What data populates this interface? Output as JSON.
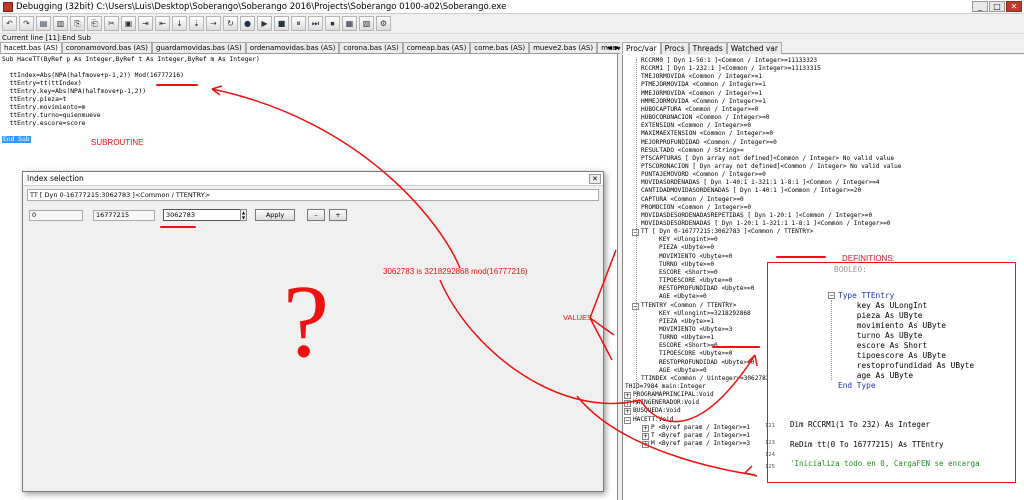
{
  "window": {
    "title": "Debugging (32bit) C:\\Users\\Luis\\Desktop\\Soberango\\Soberango 2016\\Projects\\Soberango 0100-a02\\Soberango.exe",
    "min": "_",
    "max": "□",
    "close": "✕"
  },
  "toolbar": {
    "buttons": [
      "↶",
      "↷",
      "▤",
      "▥",
      "⎘",
      "⎗",
      "✂",
      "▣",
      "⇥",
      "⇤",
      "↓",
      "⇣",
      "⇢",
      "↻",
      "●",
      "▶",
      "■",
      "⏸",
      "⏭",
      "⏹",
      "▦",
      "▧",
      "⚙"
    ]
  },
  "current_line": "Current line [11]:End Sub",
  "tabs": [
    "hacett.bas (AS)",
    "coronamovord.bas (AS)",
    "guardamovidas.bas (AS)",
    "ordenamovidas.bas (AS)",
    "corona.bas (AS)",
    "comeap.bas (AS)",
    "come.bas (AS)",
    "mueve2.bas (AS)",
    "mueve.bas (AS)",
    "mueveymovord.bas (AS)"
  ],
  "tab_arrows": "◄ ►",
  "right_tabs": [
    "Proc/var",
    "Procs",
    "Threads",
    "Watched var"
  ],
  "code": [
    "Sub HaceTT(ByRef p As Integer,ByRef t As Integer,ByRef m As Integer)",
    "",
    "  ttIndex=Abs(NPA(halfmove+p-1,2)) Mod(16777216)",
    "  ttEntry=tt(ttIndex)",
    "  ttEntry.key=Abs(NPA(halfmove+p-1,2))",
    "  ttEntry.pieza=t",
    "  ttEntry.movimiento=m",
    "  ttEntry.turno=quienmueve",
    "  ttEntry.escore=score",
    "",
    "End Sub"
  ],
  "vars_top": [
    "RCCRM0 [ Dyn 1-56:1 ]<Common / Integer>=11133323",
    "RCCRM1 [ Dyn 1-232:1 ]<Common / Integer>=11133315",
    "TMEJORMOVIDA <Common / Integer>=1",
    "PTMEJORMOVIDA <Common / Integer>=1",
    "MMEJORMOVIDA <Common / Integer>=1",
    "HMMEJORMOVIDA <Common / Integer>=1",
    "HUBOCAPTURA <Common / Integer>=0",
    "HUBOCORONACION <Common / Integer>=0",
    "EXTENSION <Common / Integer>=0",
    "MAXIMAEXTENSION <Common / Integer>=0",
    "MEJORPROFUNDIDAD <Common / Integer>=0",
    "RESULTADO <Common / String>=",
    "PTSCAPTURAS [ Dyn array not defined]<Common / Integer> No valid value",
    "PTSCORONACION [ Dyn array not defined]<Common / Integer> No valid value",
    "PUNTAJEMOVORD <Common / Integer>=0",
    "MOVIDASORDENADAS [ Dyn 1-40:1 1-321:1 1-8:1 ]<Common / Integer>=4",
    "CANTIDADMOVIDASORDENADAS [ Dyn 1-40:1 ]<Common / Integer>=20",
    "CAPTURA <Common / Integer>=0",
    "PROMOCION <Common / Integer>=0",
    "MOVIDASDESORDENADASREPETIDAS [ Dyn 1-20:1 ]<Common / Integer>=0",
    "MOVIDASDESORDENADAS [ Dyn 1-20:1 1-321:1 1-8:1 ]<Common / Integer>=0"
  ],
  "tt_header": "TT [ Dyn 0-16777215:3062783 ]<Common / TTENTRY>",
  "tt_fields": [
    "KEY <Ulongint>=0",
    "PIEZA <Ubyte>=0",
    "MOVIMIENTO <Ubyte>=0",
    "TURNO <Ubyte>=0",
    "ESCORE <Short>=0",
    "TIPOESCORE <Ubyte>=0",
    "RESTOPROFUNDIDAD <Ubyte>=0",
    "AGE <Ubyte>=0"
  ],
  "ttentry_header": "TTENTRY <Common / TTENTRY>",
  "ttentry_fields": [
    "KEY <Ulongint>=3218292868",
    "PIEZA <Ubyte>=1",
    "MOVIMIENTO <Ubyte>=3",
    "TURNO <Ubyte>=1",
    "ESCORE <Short>=0",
    "TIPOESCORE <Ubyte>=0",
    "RESTOPROFUNDIDAD <Ubyte>=0",
    "AGE <Ubyte>=0"
  ],
  "vars_bottom": [
    "TTINDEX <Common / Uinteger>=3062783",
    "THID=7984 main:Integer",
    "PROGRAMAPRINCIPAL:Void",
    "MAINGENERADOR:Void",
    "BUSQUEDA:Void",
    "HACETT:Void",
    "P <Byref param / Integer>=1",
    "T <Byref param / Integer>=1",
    "M <Byref param / Integer>=3"
  ],
  "dialog": {
    "title": "Index selection",
    "close": "✕",
    "path": "TT [ Dyn 0-16777215:3062783 ]<Common / TTENTRY>",
    "lower": "0",
    "upper": "16777215",
    "value": "3062783",
    "apply": "Apply",
    "minus": "–",
    "plus": "+"
  },
  "definitions_code": [
    "BOOLEO:",
    "",
    "Type TTEntry",
    "    key As ULongInt",
    "    pieza As UByte",
    "    movimiento As UByte",
    "    turno As UByte",
    "    escore As Short",
    "    tipoescore As UByte",
    "    restoprofundidad As UByte",
    "    age As UByte",
    "End Type"
  ],
  "lower_code": {
    "line_numbers": [
      "121",
      "123",
      "124",
      "125"
    ],
    "lines": [
      "Dim RCCRM1(1 To 232) As Integer",
      "ReDim tt(0 To 16777215) As TTEntry",
      "'Inicializa todo en 0, CargaFEN se encarga"
    ]
  },
  "annotations": {
    "subroutine": "SUBROUTINE",
    "definitions": "DEFINITIONS:",
    "values": "VALUES:",
    "modulo": "3062783 is  3218292868 mod(16777216)",
    "question": "?"
  },
  "colors": {
    "annotation_red": "#ee1111",
    "keyword_blue": "#1f2fa8",
    "selection_blue": "#3399ff"
  }
}
